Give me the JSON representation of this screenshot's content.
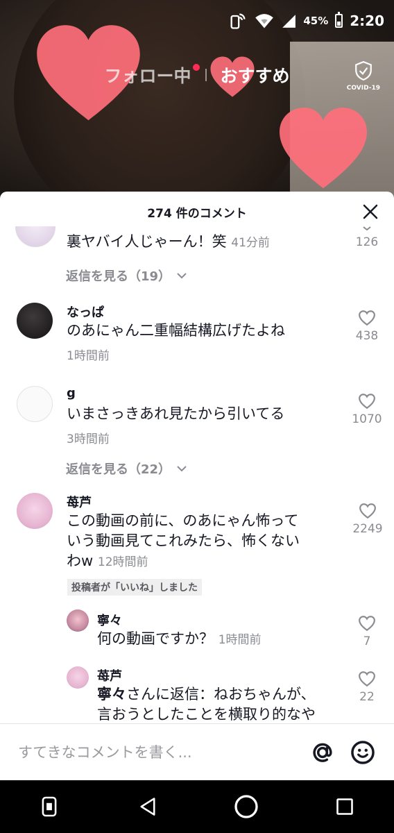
{
  "status_bar": {
    "battery": "45%",
    "time": "2:20"
  },
  "feed_tabs": {
    "following": "フォロー中",
    "recommended": "おすすめ",
    "covid_label": "COVID-19"
  },
  "sheet": {
    "title": "274 件のコメント"
  },
  "comments": [
    {
      "text": "裏ヤバイ人じゃーん！笑",
      "time": "41分前",
      "likes": "126",
      "replies": "返信を見る（19）"
    },
    {
      "name": "なっぱ",
      "text": "のあにゃん二重幅結構広げたよね",
      "time": "1時間前",
      "likes": "438"
    },
    {
      "name": "g",
      "text": "いまさっきあれ見たから引いてる",
      "time": "3時間前",
      "likes": "1070",
      "replies": "返信を見る（22）"
    },
    {
      "name": "苺芦",
      "text_line1": "この動画の前に、のあにゃん怖って",
      "text_line2": "いう動画見てこれみたら、怖くない",
      "text_line3": "わw",
      "time": "12時間前",
      "likes": "2249",
      "badge": "投稿者が「いいね」しました"
    }
  ],
  "replies": [
    {
      "name": "寧々",
      "text": "何の動画ですか？",
      "time": "1時間前",
      "likes": "7"
    },
    {
      "name": "苺芦",
      "mention": "寧々",
      "mention_suffix": "さんに返信：ねおちゃんが、",
      "text_line2": "言おうとしたことを横取り的なや",
      "likes": "22"
    }
  ],
  "input": {
    "placeholder": "すてきなコメントを書く..."
  }
}
